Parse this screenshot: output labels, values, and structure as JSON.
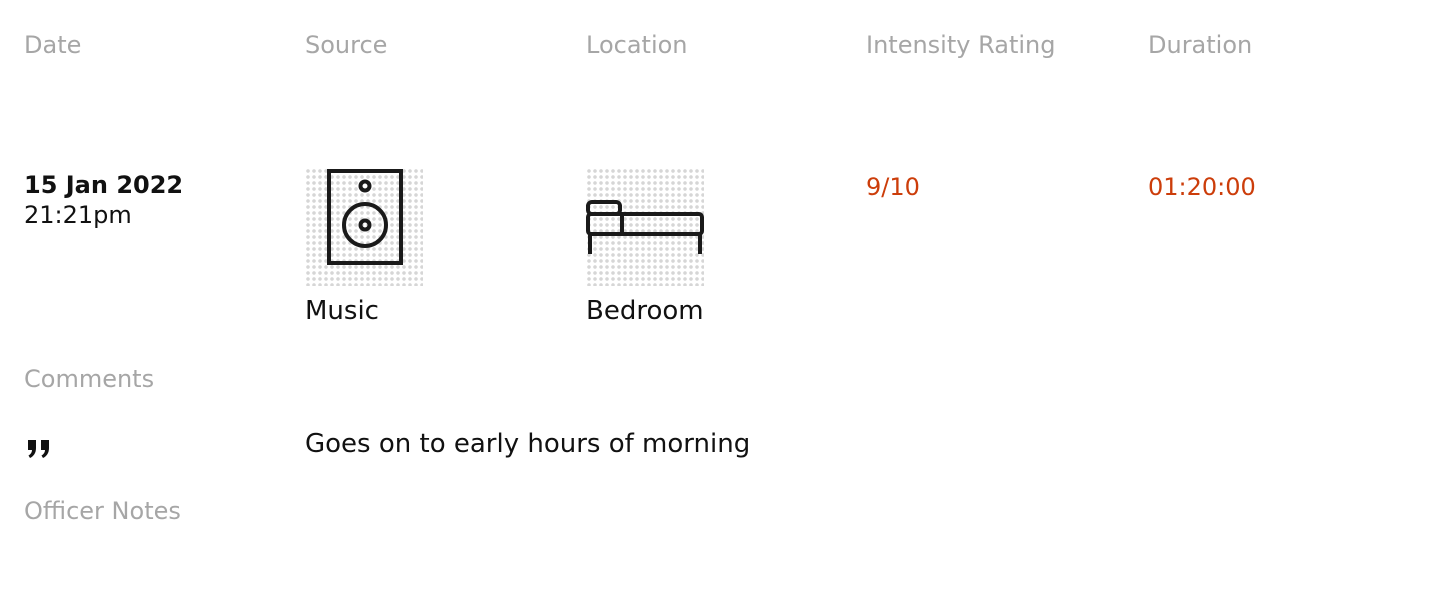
{
  "headers": {
    "date": "Date",
    "source": "Source",
    "location": "Location",
    "intensity": "Intensity Rating",
    "duration": "Duration"
  },
  "entry": {
    "date": "15 Jan 2022",
    "time": "21:21pm",
    "source": {
      "label": "Music",
      "icon": "speaker-icon"
    },
    "location": {
      "label": "Bedroom",
      "icon": "bed-icon"
    },
    "intensity": "9/10",
    "duration": "01:20:00"
  },
  "comments": {
    "label": "Comments",
    "quote_icon": "quote-icon",
    "text": "Goes on to early hours of morning"
  },
  "officer_notes": {
    "label": "Officer Notes"
  },
  "colors": {
    "header": "#a6a6a6",
    "accent": "#cc3d0a",
    "text": "#111111"
  }
}
